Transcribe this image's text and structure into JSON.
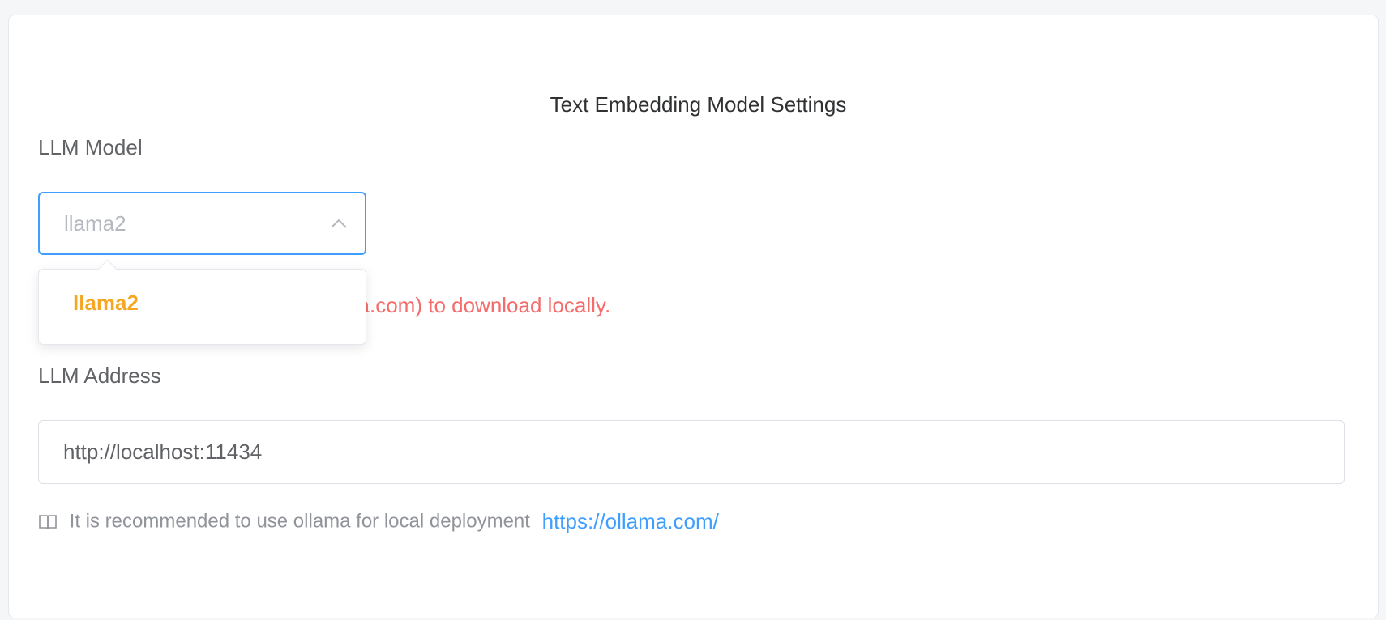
{
  "section": {
    "title": "Text Embedding Model Settings"
  },
  "llm_model": {
    "label": "LLM Model",
    "selected_placeholder": "llama2",
    "options": [
      "llama2"
    ],
    "error_text": "d, please use ollama (https://ollama.com) to download locally."
  },
  "llm_address": {
    "label": "LLM Address",
    "value": "http://localhost:11434"
  },
  "hint": {
    "text": "It is recommended to use ollama for local deployment",
    "link_text": "https://ollama.com/"
  },
  "icons": {
    "select_toggle": "chevron-up-icon",
    "hint": "book-icon"
  },
  "colors": {
    "accent": "#409eff",
    "error": "#f56c6c",
    "selected_option": "#f5a623"
  }
}
